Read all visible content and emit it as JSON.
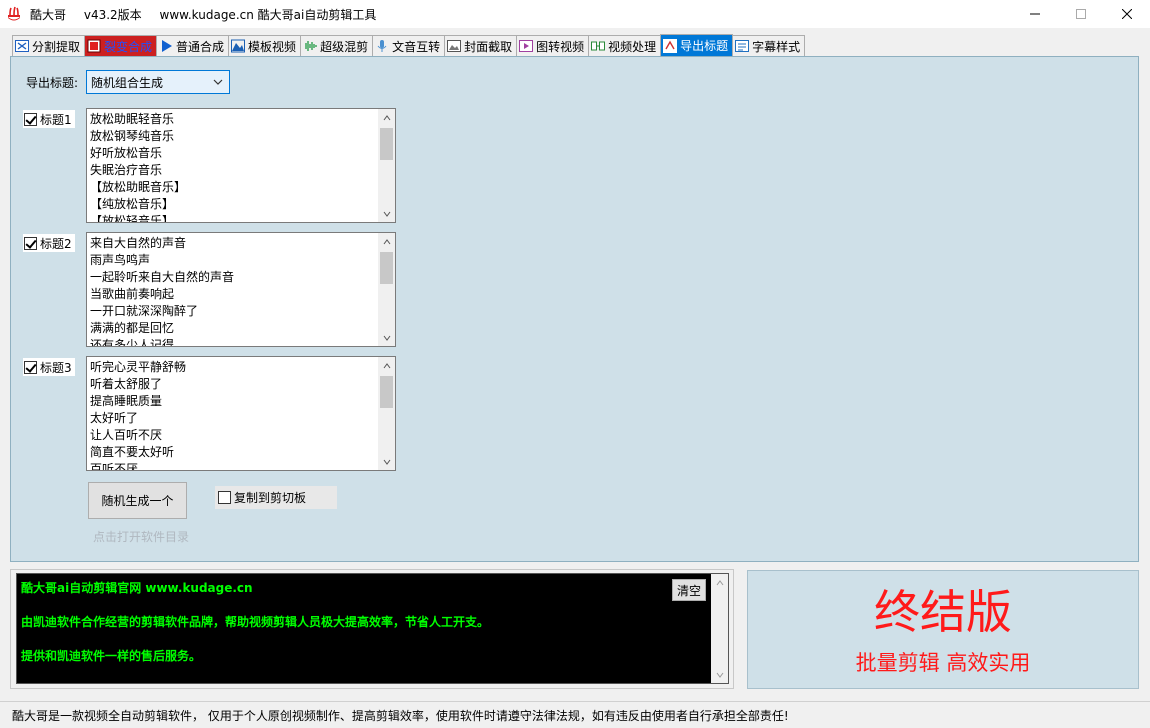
{
  "window": {
    "app_name": "酷大哥",
    "version": "v43.2版本",
    "site": "www.kudage.cn 酷大哥ai自动剪辑工具"
  },
  "tabs": [
    {
      "label": "分割提取",
      "icon": "scissors-icon"
    },
    {
      "label": "裂变合成",
      "icon": "fission-icon"
    },
    {
      "label": "普通合成",
      "icon": "play-icon"
    },
    {
      "label": "模板视频",
      "icon": "template-icon"
    },
    {
      "label": "超级混剪",
      "icon": "audio-wave-icon"
    },
    {
      "label": "文音互转",
      "icon": "microphone-icon"
    },
    {
      "label": "封面截取",
      "icon": "image-icon"
    },
    {
      "label": "图转视频",
      "icon": "photo-video-icon"
    },
    {
      "label": "视频处理",
      "icon": "video-process-icon"
    },
    {
      "label": "导出标题",
      "icon": "export-title-icon"
    },
    {
      "label": "字幕样式",
      "icon": "subtitle-icon"
    }
  ],
  "export": {
    "label": "导出标题:",
    "mode_selected": "随机组合生成"
  },
  "titles": [
    {
      "label": "标题1",
      "checked": true,
      "items": [
        "放松助眠轻音乐",
        "放松钢琴纯音乐",
        "好听放松音乐",
        "失眠治疗音乐",
        "【放松助眠音乐】",
        "【纯放松音乐】",
        "【放松轻音乐】"
      ]
    },
    {
      "label": "标题2",
      "checked": true,
      "items": [
        "来自大自然的声音",
        "雨声鸟鸣声",
        "一起聆听来自大自然的声音",
        "当歌曲前奏响起",
        "一开口就深深陶醉了",
        "满满的都是回忆",
        "还有多少人记得"
      ]
    },
    {
      "label": "标题3",
      "checked": true,
      "items": [
        "听完心灵平静舒畅",
        "听着太舒服了",
        "提高睡眠质量",
        "太好听了",
        "让人百听不厌",
        "简直不要太好听",
        "百听不厌"
      ]
    }
  ],
  "actions": {
    "generate_label": "随机生成一个",
    "copy_label": "复制到剪切板",
    "open_dir_label": "点击打开软件目录"
  },
  "console": {
    "lines": [
      "酷大哥ai自动剪辑官网  www.kudage.cn",
      "由凯迪软件合作经营的剪辑软件品牌，帮助视频剪辑人员极大提高效率，节省人工开支。",
      "提供和凯迪软件一样的售后服务。"
    ],
    "clear_label": "清空"
  },
  "banner": {
    "title": "终结版",
    "subtitle": "批量剪辑 高效实用",
    "color": "#ff1a1a"
  },
  "status": {
    "text": "酷大哥是一款视频全自动剪辑软件， 仅用于个人原创视频制作、提高剪辑效率，使用软件时请遵守法律法规，如有违反由使用者自行承担全部责任!"
  },
  "colors": {
    "panel_bg": "#cfe0e8",
    "active_tab": "#0078d7",
    "console_text": "#00ff00"
  }
}
